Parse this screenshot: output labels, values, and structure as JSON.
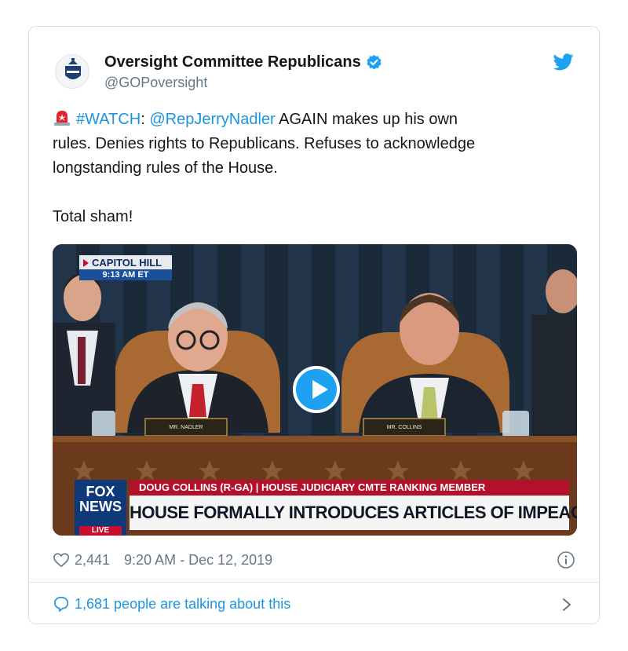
{
  "account": {
    "display_name": "Oversight Committee Republicans",
    "handle": "@GOPoversight"
  },
  "tweet": {
    "hashtag": "#WATCH",
    "colon": ":",
    "mention": "@RepJerryNadler",
    "line1_rest": " AGAIN makes up his own",
    "line2": "rules. Denies rights to Republicans. Refuses to acknowledge",
    "line3": "longstanding rules of the House.",
    "closing": "Total sham!"
  },
  "video": {
    "location_badge": "CAPITOL HILL",
    "time_badge": "9:13 AM ET",
    "chyron_top": "DOUG COLLINS (R-GA) | HOUSE JUDICIARY CMTE RANKING MEMBER",
    "chyron_main": "HOUSE FORMALLY INTRODUCES ARTICLES OF IMPEACHMENT",
    "network_line1": "FOX",
    "network_line2": "NEWS",
    "live_label": "LIVE",
    "nameplate_left": "MR. NADLER",
    "nameplate_right": "MR. COLLINS"
  },
  "meta": {
    "likes": "2,441",
    "timestamp": "9:20 AM - Dec 12, 2019"
  },
  "footer": {
    "talking": "1,681 people are talking about this"
  },
  "colors": {
    "link": "#1b95e0",
    "verified": "#1da1f2",
    "chyron_red": "#b3112a"
  }
}
